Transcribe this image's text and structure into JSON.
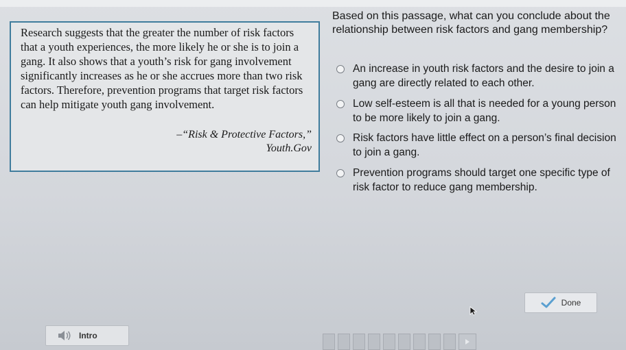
{
  "passage": {
    "text": "Research suggests that the greater the number of risk factors that a youth experiences, the more likely he or she is to join a gang. It also shows that a youth’s risk for gang involvement significantly increases as he or she accrues more than two risk factors. Therefore, prevention programs that target risk factors can help mitigate youth gang involvement.",
    "attribution_line1": "–“Risk & Protective Factors,”",
    "attribution_line2": "Youth.Gov"
  },
  "question": {
    "text": "Based on this passage, what can you conclude about the relationship between risk factors and gang membership?"
  },
  "options": [
    {
      "label": "An increase in youth risk factors and the desire to join a gang are directly related to each other."
    },
    {
      "label": "Low self-esteem is all that is needed for a young person to be more likely to join a gang."
    },
    {
      "label": "Risk factors have little effect on a person’s final decision to join a gang."
    },
    {
      "label": "Prevention programs should target one specific type of risk factor to reduce gang membership."
    }
  ],
  "footer": {
    "done_label": "Done",
    "intro_label": "Intro"
  },
  "colors": {
    "passage_border": "#3f7c9c",
    "check_green": "#5a9fd0"
  },
  "icons": {
    "done": "check-icon",
    "intro": "speaker-icon",
    "next": "play-triangle-icon"
  }
}
